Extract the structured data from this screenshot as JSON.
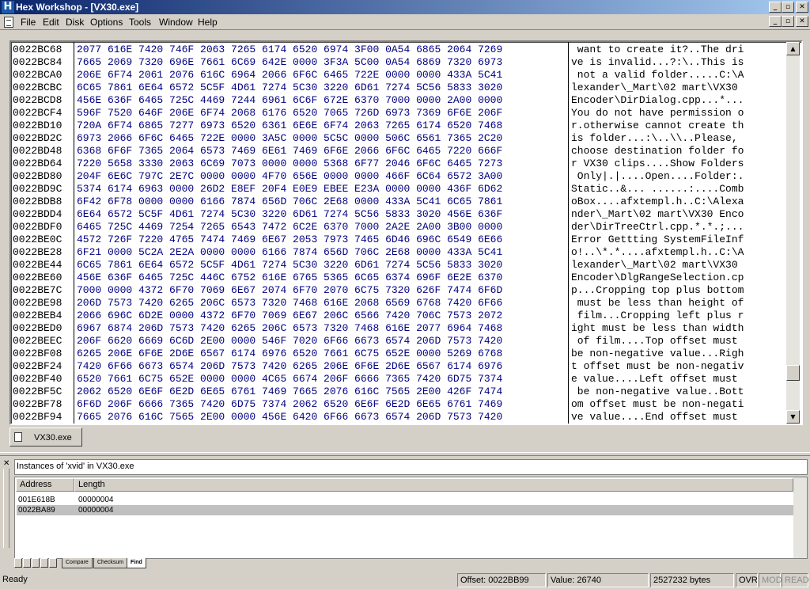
{
  "window": {
    "title": "Hex Workshop - [VX30.exe]",
    "app_icon": "H"
  },
  "menu": [
    "File",
    "Edit",
    "Disk",
    "Options",
    "Tools",
    "Window",
    "Help"
  ],
  "hex_rows": [
    {
      "addr": "0022BC68",
      "hex": "2077 616E 7420 746F 2063 7265 6174 6520 6974 3F00 0A54 6865 2064 7269",
      "ascii": " want to create it?..The dri"
    },
    {
      "addr": "0022BC84",
      "hex": "7665 2069 7320 696E 7661 6C69 642E 0000 3F3A 5C00 0A54 6869 7320 6973",
      "ascii": "ve is invalid...?:\\..This is"
    },
    {
      "addr": "0022BCA0",
      "hex": "206E 6F74 2061 2076 616C 6964 2066 6F6C 6465 722E 0000 0000 433A 5C41",
      "ascii": " not a valid folder.....C:\\A"
    },
    {
      "addr": "0022BCBC",
      "hex": "6C65 7861 6E64 6572 5C5F 4D61 7274 5C30 3220 6D61 7274 5C56 5833 3020",
      "ascii": "lexander\\_Mart\\02 mart\\VX30 "
    },
    {
      "addr": "0022BCD8",
      "hex": "456E 636F 6465 725C 4469 7244 6961 6C6F 672E 6370 7000 0000 2A00 0000",
      "ascii": "Encoder\\DirDialog.cpp...*..."
    },
    {
      "addr": "0022BCF4",
      "hex": "596F 7520 646F 206E 6F74 2068 6176 6520 7065 726D 6973 7369 6F6E 206F",
      "ascii": "You do not have permission o"
    },
    {
      "addr": "0022BD10",
      "hex": "720A 6F74 6865 7277 6973 6520 6361 6E6E 6F74 2063 7265 6174 6520 7468",
      "ascii": "r.otherwise cannot create th"
    },
    {
      "addr": "0022BD2C",
      "hex": "6973 2066 6F6C 6465 722E 0000 3A5C 0000 5C5C 0000 506C 6561 7365 2C20",
      "ascii": "is folder...:\\..\\\\..Please, "
    },
    {
      "addr": "0022BD48",
      "hex": "6368 6F6F 7365 2064 6573 7469 6E61 7469 6F6E 2066 6F6C 6465 7220 666F",
      "ascii": "choose destination folder fo"
    },
    {
      "addr": "0022BD64",
      "hex": "7220 5658 3330 2063 6C69 7073 0000 0000 5368 6F77 2046 6F6C 6465 7273",
      "ascii": "r VX30 clips....Show Folders"
    },
    {
      "addr": "0022BD80",
      "hex": "204F 6E6C 797C 2E7C 0000 0000 4F70 656E 0000 0000 466F 6C64 6572 3A00",
      "ascii": " Only|.|....Open....Folder:."
    },
    {
      "addr": "0022BD9C",
      "hex": "5374 6174 6963 0000 26D2 E8EF 20F4 E0E9 EBEE E23A 0000 0000 436F 6D62",
      "ascii": "Static..&... ......:....Comb"
    },
    {
      "addr": "0022BDB8",
      "hex": "6F42 6F78 0000 0000 6166 7874 656D 706C 2E68 0000 433A 5C41 6C65 7861",
      "ascii": "oBox....afxtempl.h..C:\\Alexa"
    },
    {
      "addr": "0022BDD4",
      "hex": "6E64 6572 5C5F 4D61 7274 5C30 3220 6D61 7274 5C56 5833 3020 456E 636F",
      "ascii": "nder\\_Mart\\02 mart\\VX30 Enco"
    },
    {
      "addr": "0022BDF0",
      "hex": "6465 725C 4469 7254 7265 6543 7472 6C2E 6370 7000 2A2E 2A00 3B00 0000",
      "ascii": "der\\DirTreeCtrl.cpp.*.*.;..."
    },
    {
      "addr": "0022BE0C",
      "hex": "4572 726F 7220 4765 7474 7469 6E67 2053 7973 7465 6D46 696C 6549 6E66",
      "ascii": "Error Gettting SystemFileInf"
    },
    {
      "addr": "0022BE28",
      "hex": "6F21 0000 5C2A 2E2A 0000 0000 6166 7874 656D 706C 2E68 0000 433A 5C41",
      "ascii": "o!..\\*.*....afxtempl.h..C:\\A"
    },
    {
      "addr": "0022BE44",
      "hex": "6C65 7861 6E64 6572 5C5F 4D61 7274 5C30 3220 6D61 7274 5C56 5833 3020",
      "ascii": "lexander\\_Mart\\02 mart\\VX30 "
    },
    {
      "addr": "0022BE60",
      "hex": "456E 636F 6465 725C 446C 6752 616E 6765 5365 6C65 6374 696F 6E2E 6370",
      "ascii": "Encoder\\DlgRangeSelection.cp"
    },
    {
      "addr": "0022BE7C",
      "hex": "7000 0000 4372 6F70 7069 6E67 2074 6F70 2070 6C75 7320 626F 7474 6F6D",
      "ascii": "p...Cropping top plus bottom"
    },
    {
      "addr": "0022BE98",
      "hex": "206D 7573 7420 6265 206C 6573 7320 7468 616E 2068 6569 6768 7420 6F66",
      "ascii": " must be less than height of"
    },
    {
      "addr": "0022BEB4",
      "hex": "2066 696C 6D2E 0000 4372 6F70 7069 6E67 206C 6566 7420 706C 7573 2072",
      "ascii": " film...Cropping left plus r"
    },
    {
      "addr": "0022BED0",
      "hex": "6967 6874 206D 7573 7420 6265 206C 6573 7320 7468 616E 2077 6964 7468",
      "ascii": "ight must be less than width"
    },
    {
      "addr": "0022BEEC",
      "hex": "206F 6620 6669 6C6D 2E00 0000 546F 7020 6F66 6673 6574 206D 7573 7420",
      "ascii": " of film....Top offset must "
    },
    {
      "addr": "0022BF08",
      "hex": "6265 206E 6F6E 2D6E 6567 6174 6976 6520 7661 6C75 652E 0000 5269 6768",
      "ascii": "be non-negative value...Righ"
    },
    {
      "addr": "0022BF24",
      "hex": "7420 6F66 6673 6574 206D 7573 7420 6265 206E 6F6E 2D6E 6567 6174 6976",
      "ascii": "t offset must be non-negativ"
    },
    {
      "addr": "0022BF40",
      "hex": "6520 7661 6C75 652E 0000 0000 4C65 6674 206F 6666 7365 7420 6D75 7374",
      "ascii": "e value....Left offset must"
    },
    {
      "addr": "0022BF5C",
      "hex": "2062 6520 6E6F 6E2D 6E65 6761 7469 7665 2076 616C 7565 2E00 426F 7474",
      "ascii": " be non-negative value..Bott"
    },
    {
      "addr": "0022BF78",
      "hex": "6F6D 206F 6666 7365 7420 6D75 7374 2062 6520 6E6F 6E2D 6E65 6761 7469",
      "ascii": "om offset must be non-negati"
    },
    {
      "addr": "0022BF94",
      "hex": "7665 2076 616C 7565 2E00 0000 456E 6420 6F66 6673 6574 206D 7573 7420",
      "ascii": "ve value....End offset must "
    }
  ],
  "document_tab": "VX30.exe",
  "results": {
    "header": "Instances of 'xvid' in VX30.exe",
    "columns": [
      "Address",
      "Length"
    ],
    "rows": [
      {
        "address": "001E618B",
        "length": "00000004"
      },
      {
        "address": "0022BA89",
        "length": "00000004"
      }
    ],
    "selected_row": 1,
    "tabs": [
      "Compare",
      "Checksum",
      "Find"
    ],
    "active_tab": "Find"
  },
  "status": {
    "ready": "Ready",
    "offset": "Offset: 0022BB99",
    "value": "Value: 26740",
    "size": "2527232 bytes",
    "ovr": "OVR",
    "mod": "MOD",
    "read": "READ"
  }
}
